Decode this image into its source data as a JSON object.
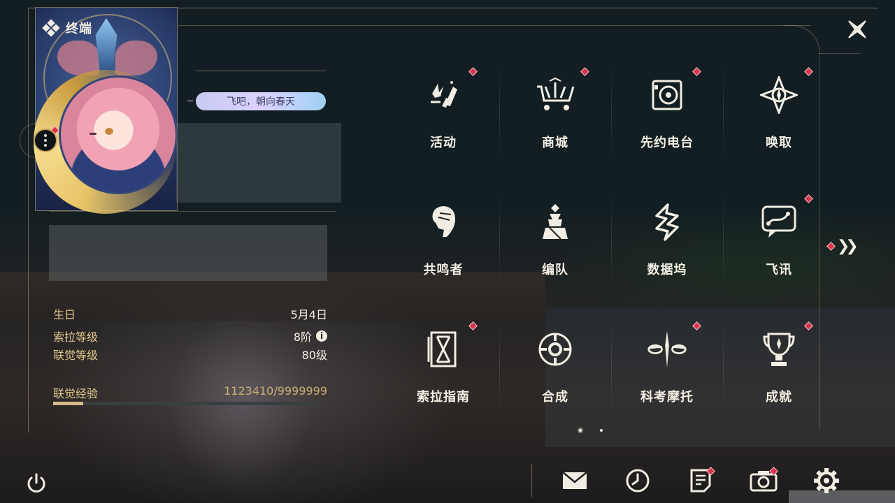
{
  "header": {
    "title": "终端"
  },
  "profile": {
    "signature": "飞吧，朝向春天",
    "stats": [
      {
        "label": "生日",
        "value": "5月4日",
        "info": false
      },
      {
        "label": "索拉等级",
        "value": "8阶",
        "info": true
      },
      {
        "label": "联觉等级",
        "value": "80级",
        "info": false
      }
    ],
    "exp": {
      "label": "联觉经验",
      "value": "1123410/9999999",
      "progress": 0.1123
    }
  },
  "menu": {
    "items": [
      {
        "label": "活动",
        "icon": "activity-icon",
        "badge": true
      },
      {
        "label": "商城",
        "icon": "shop-icon",
        "badge": true
      },
      {
        "label": "先约电台",
        "icon": "radio-icon",
        "badge": true
      },
      {
        "label": "唤取",
        "icon": "gacha-icon",
        "badge": true
      },
      {
        "label": "共鸣者",
        "icon": "resonator-icon",
        "badge": false
      },
      {
        "label": "编队",
        "icon": "team-icon",
        "badge": false
      },
      {
        "label": "数据坞",
        "icon": "data-bank-icon",
        "badge": false
      },
      {
        "label": "飞讯",
        "icon": "message-icon",
        "badge": true
      },
      {
        "label": "索拉指南",
        "icon": "guidebook-icon",
        "badge": true
      },
      {
        "label": "合成",
        "icon": "synthesis-icon",
        "badge": false
      },
      {
        "label": "科考摩托",
        "icon": "motorbike-icon",
        "badge": true
      },
      {
        "label": "成就",
        "icon": "trophy-icon",
        "badge": true
      }
    ],
    "page_count": 2,
    "current_page": 1
  },
  "bottom_bar": {
    "items": [
      {
        "icon": "mail-icon",
        "badge": false
      },
      {
        "icon": "clock-icon",
        "badge": false
      },
      {
        "icon": "notes-icon",
        "badge": true
      },
      {
        "icon": "camera-icon",
        "badge": true
      },
      {
        "icon": "settings-gear-icon",
        "badge": false
      }
    ]
  },
  "colors": {
    "accent_gold": "#e2c98e",
    "badge_red": "#d8344a",
    "text_light": "#f1ede2"
  }
}
